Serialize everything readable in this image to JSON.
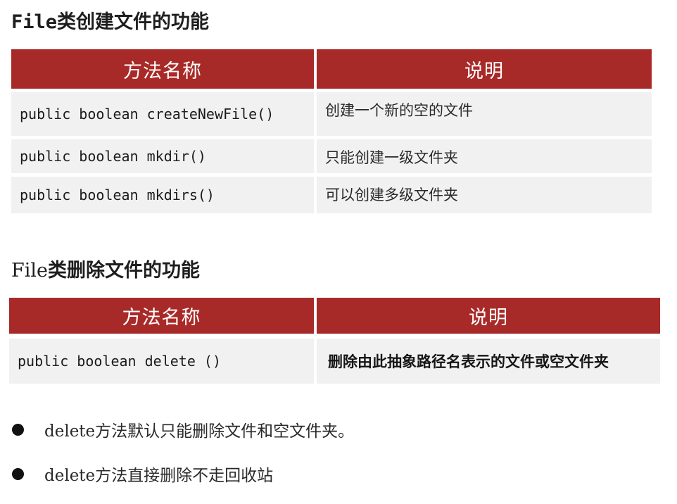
{
  "section_create": {
    "title_prefix": "File",
    "title_suffix": "类创建文件的功能",
    "header_method": "方法名称",
    "header_desc": "说明",
    "rows": [
      {
        "method": "public boolean createNewFile()",
        "desc": "创建一个新的空的文件"
      },
      {
        "method": "public boolean mkdir()",
        "desc": "只能创建一级文件夹"
      },
      {
        "method": "public boolean mkdirs()",
        "desc": "可以创建多级文件夹"
      }
    ]
  },
  "section_delete": {
    "title_prefix": "File",
    "title_suffix": "类删除文件的功能",
    "header_method": "方法名称",
    "header_desc": "说明",
    "rows": [
      {
        "method": "public boolean delete ()",
        "desc": "删除由此抽象路径名表示的文件或空文件夹"
      }
    ]
  },
  "notes": [
    {
      "text": "delete方法默认只能删除文件和空文件夹。"
    },
    {
      "text": "delete方法直接删除不走回收站"
    }
  ],
  "colors": {
    "header_bg": "#a82a28",
    "cell_bg": "#f1f1f1"
  }
}
